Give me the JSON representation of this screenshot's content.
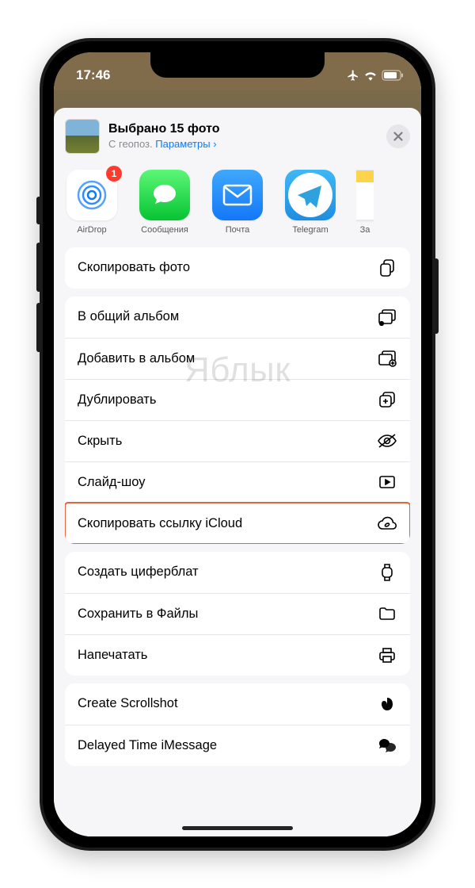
{
  "status": {
    "time": "17:46"
  },
  "header": {
    "title": "Выбрано 15 фото",
    "subtitle_prefix": "С геопоз.",
    "subtitle_params": "Параметры",
    "subtitle_chevron": "›"
  },
  "apps": {
    "airdrop": {
      "label": "AirDrop",
      "badge": "1"
    },
    "messages": {
      "label": "Сообщения"
    },
    "mail": {
      "label": "Почта"
    },
    "telegram": {
      "label": "Telegram"
    },
    "notes": {
      "label": "За"
    }
  },
  "actions": {
    "copy_photo": "Скопировать фото",
    "shared_album": "В общий альбом",
    "add_to_album": "Добавить в альбом",
    "duplicate": "Дублировать",
    "hide": "Скрыть",
    "slideshow": "Слайд-шоу",
    "copy_icloud_link": "Скопировать ссылку iCloud",
    "create_watchface": "Создать циферблат",
    "save_to_files": "Сохранить в Файлы",
    "print": "Напечатать",
    "create_scrollshot": "Create Scrollshot",
    "delayed_imessage": "Delayed Time iMessage"
  },
  "watermark": "Яблык"
}
